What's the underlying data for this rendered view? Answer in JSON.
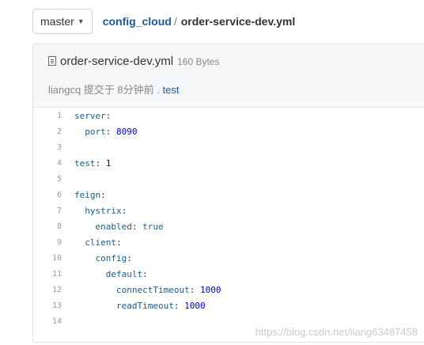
{
  "branch": {
    "label": "master"
  },
  "breadcrumb": {
    "repo": "config_cloud",
    "separator": "/",
    "file": "order-service-dev.yml"
  },
  "file": {
    "name": "order-service-dev.yml",
    "size": "160 Bytes",
    "commit_prefix": "liangcq 提交于 8分钟前 . ",
    "commit_message": "test"
  },
  "code_lines": [
    {
      "num": "1",
      "indent": "",
      "key": "server",
      "colon": ":",
      "value": "",
      "vtype": ""
    },
    {
      "num": "2",
      "indent": "  ",
      "key": "port",
      "colon": ": ",
      "value": "8090",
      "vtype": "n"
    },
    {
      "num": "3",
      "indent": "",
      "key": "",
      "colon": "",
      "value": "",
      "vtype": ""
    },
    {
      "num": "4",
      "indent": "",
      "key": "test",
      "colon": ": ",
      "value": "1",
      "vtype": "n"
    },
    {
      "num": "5",
      "indent": "",
      "key": "",
      "colon": "",
      "value": "",
      "vtype": ""
    },
    {
      "num": "6",
      "indent": "",
      "key": "feign",
      "colon": ":",
      "value": "",
      "vtype": ""
    },
    {
      "num": "7",
      "indent": "  ",
      "key": "hystrix",
      "colon": ":",
      "value": "",
      "vtype": ""
    },
    {
      "num": "8",
      "indent": "    ",
      "key": "enabled",
      "colon": ": ",
      "value": "true",
      "vtype": "b"
    },
    {
      "num": "9",
      "indent": "  ",
      "key": "client",
      "colon": ":",
      "value": "",
      "vtype": ""
    },
    {
      "num": "10",
      "indent": "    ",
      "key": "config",
      "colon": ":",
      "value": "",
      "vtype": ""
    },
    {
      "num": "11",
      "indent": "      ",
      "key": "default",
      "colon": ":",
      "value": "",
      "vtype": ""
    },
    {
      "num": "12",
      "indent": "        ",
      "key": "connectTimeout",
      "colon": ": ",
      "value": "1000",
      "vtype": "n"
    },
    {
      "num": "13",
      "indent": "        ",
      "key": "readTimeout",
      "colon": ": ",
      "value": "1000",
      "vtype": "n"
    },
    {
      "num": "14",
      "indent": "",
      "key": "",
      "colon": "",
      "value": "",
      "vtype": ""
    }
  ],
  "watermark": "https://blog.csdn.net/liang63487458",
  "icons": {
    "file": "file-text-icon",
    "caret": "caret-down-icon"
  }
}
